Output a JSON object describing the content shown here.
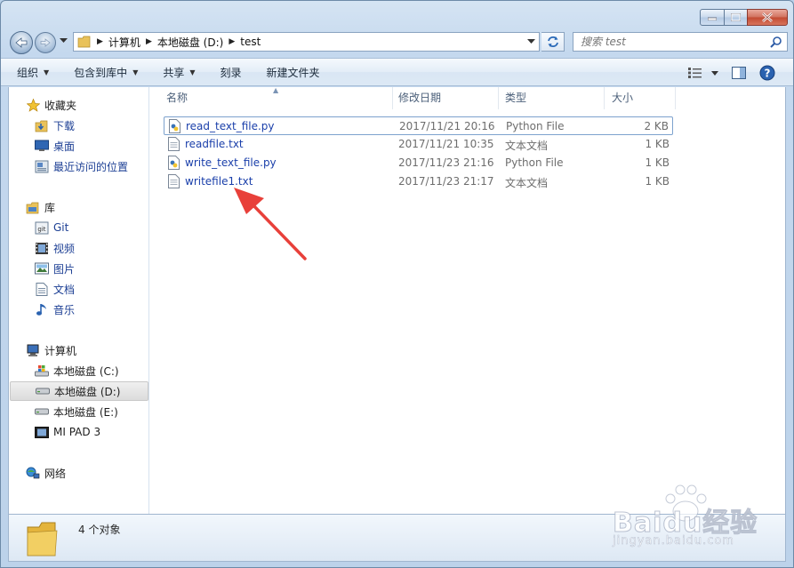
{
  "address": {
    "crumbs": [
      "计算机",
      "本地磁盘 (D:)",
      "test"
    ]
  },
  "search": {
    "placeholder": "搜索 test"
  },
  "toolbar": {
    "organize": "组织",
    "include_in_library": "包含到库中",
    "share": "共享",
    "burn": "刻录",
    "new_folder": "新建文件夹"
  },
  "nav": {
    "favorites": {
      "label": "收藏夹",
      "items": [
        {
          "label": "下载",
          "icon": "download-folder-icon"
        },
        {
          "label": "桌面",
          "icon": "desktop-icon"
        },
        {
          "label": "最近访问的位置",
          "icon": "recent-places-icon"
        }
      ]
    },
    "libraries": {
      "label": "库",
      "items": [
        {
          "label": "Git",
          "icon": "git-library-icon"
        },
        {
          "label": "视频",
          "icon": "video-library-icon"
        },
        {
          "label": "图片",
          "icon": "pictures-library-icon"
        },
        {
          "label": "文档",
          "icon": "documents-library-icon"
        },
        {
          "label": "音乐",
          "icon": "music-library-icon"
        }
      ]
    },
    "computer": {
      "label": "计算机",
      "items": [
        {
          "label": "本地磁盘 (C:)",
          "icon": "system-drive-icon"
        },
        {
          "label": "本地磁盘 (D:)",
          "icon": "drive-icon",
          "selected": true
        },
        {
          "label": "本地磁盘 (E:)",
          "icon": "drive-icon"
        },
        {
          "label": "MI PAD 3",
          "icon": "device-icon"
        }
      ]
    },
    "network": {
      "label": "网络"
    }
  },
  "columns": {
    "name": "名称",
    "date": "修改日期",
    "type": "类型",
    "size": "大小"
  },
  "files": [
    {
      "name": "read_text_file.py",
      "date": "2017/11/21 20:16",
      "type": "Python File",
      "size": "2 KB",
      "icon": "python-file-icon"
    },
    {
      "name": "readfile.txt",
      "date": "2017/11/21 10:35",
      "type": "文本文档",
      "size": "1 KB",
      "icon": "text-file-icon"
    },
    {
      "name": "write_text_file.py",
      "date": "2017/11/23 21:16",
      "type": "Python File",
      "size": "1 KB",
      "icon": "python-file-icon"
    },
    {
      "name": "writefile1.txt",
      "date": "2017/11/23 21:17",
      "type": "文本文档",
      "size": "1 KB",
      "icon": "text-file-icon"
    }
  ],
  "status": {
    "count": "4 个对象"
  },
  "watermark": {
    "text": "Baidu经验",
    "sub": "jingyan.baidu.com"
  },
  "colors": {
    "link_blue": "#1a3faa",
    "annotation_red": "#e8403a",
    "accent": "#2c5ba6"
  }
}
